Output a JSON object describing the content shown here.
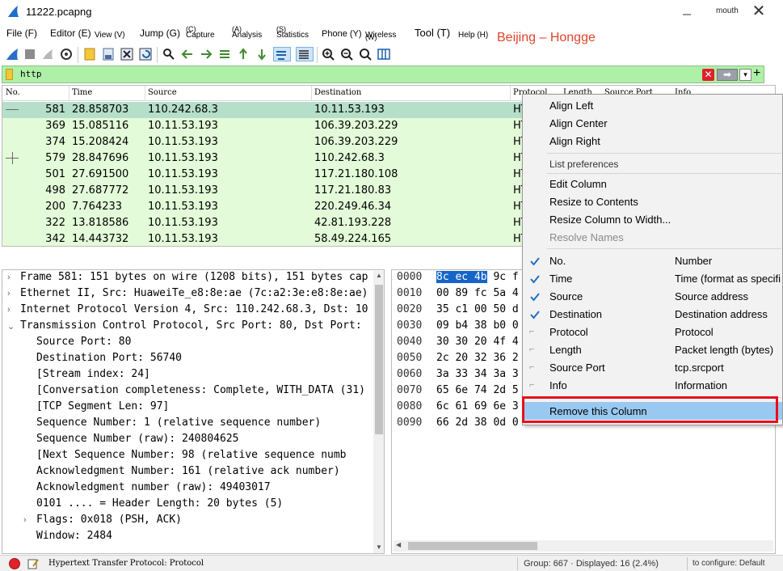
{
  "window": {
    "title": "11222.pcapng",
    "user_label": "mouth",
    "close_glyph": "✕",
    "min_glyph": "—"
  },
  "menubar": {
    "items": [
      {
        "label": "File (F)"
      },
      {
        "label": "Editor (E)"
      },
      {
        "label": "View (V)"
      },
      {
        "label": "Jump (G)"
      },
      {
        "label": "Capture",
        "key": "(C)"
      },
      {
        "label": "Analysis",
        "key": "(A)"
      },
      {
        "label": "Statistics",
        "key": "(S)"
      },
      {
        "label": "Phone (Y)"
      },
      {
        "label": "Wireless",
        "key": "(W)"
      },
      {
        "label": "Tool (T)"
      },
      {
        "label": "Help (H)"
      }
    ],
    "watermark": "Beijing – Hongge"
  },
  "filter": {
    "value": "http",
    "clear_glyph": "✕",
    "apply_glyph": "➡",
    "dropdown_glyph": "▾",
    "plus_glyph": "+"
  },
  "packet_list": {
    "columns": [
      "No.",
      "Time",
      "Source",
      "Destination",
      "Protocol",
      "Length",
      "Source Port",
      "Info"
    ],
    "rows": [
      {
        "no": "581",
        "time": "28.858703",
        "src": "110.242.68.3",
        "dst": "10.11.53.193",
        "proto": "HT"
      },
      {
        "no": "369",
        "time": "15.085116",
        "src": "10.11.53.193",
        "dst": "106.39.203.229",
        "proto": "HT"
      },
      {
        "no": "374",
        "time": "15.208424",
        "src": "10.11.53.193",
        "dst": "106.39.203.229",
        "proto": "HT"
      },
      {
        "no": "579",
        "time": "28.847696",
        "src": "10.11.53.193",
        "dst": "110.242.68.3",
        "proto": "HT"
      },
      {
        "no": "501",
        "time": "27.691500",
        "src": "10.11.53.193",
        "dst": "117.21.180.108",
        "proto": "HT"
      },
      {
        "no": "498",
        "time": "27.687772",
        "src": "10.11.53.193",
        "dst": "117.21.180.83",
        "proto": "HT"
      },
      {
        "no": "200",
        "time": "7.764233",
        "src": "10.11.53.193",
        "dst": "220.249.46.34",
        "proto": "HT"
      },
      {
        "no": "322",
        "time": "13.818586",
        "src": "10.11.53.193",
        "dst": "42.81.193.228",
        "proto": "HT"
      },
      {
        "no": "342",
        "time": "14.443732",
        "src": "10.11.53.193",
        "dst": "58.49.224.165",
        "proto": "HT"
      }
    ]
  },
  "details": {
    "lines": [
      {
        "text": "Frame 581: 151 bytes on wire (1208 bits), 151 bytes cap",
        "arrow": "›"
      },
      {
        "text": "Ethernet II, Src: HuaweiTe_e8:8e:ae (7c:a2:3e:e8:8e:ae)",
        "arrow": "›"
      },
      {
        "text": "Internet Protocol Version 4, Src: 110.242.68.3, Dst: 10",
        "arrow": "›"
      },
      {
        "text": "Transmission Control Protocol, Src Port: 80, Dst Port:",
        "arrow": "⌄"
      },
      {
        "text": "Source Port: 80"
      },
      {
        "text": "Destination Port: 56740"
      },
      {
        "text": "[Stream index: 24]"
      },
      {
        "text": "[Conversation completeness: Complete, WITH_DATA (31)"
      },
      {
        "text": "[TCP Segment Len: 97]"
      },
      {
        "text": "Sequence Number: 1    (relative sequence number)"
      },
      {
        "text": "Sequence Number (raw): 240804625"
      },
      {
        "text": "[Next Sequence Number: 98    (relative sequence numb"
      },
      {
        "text": "Acknowledgment Number: 161    (relative ack number)"
      },
      {
        "text": "Acknowledgment number (raw): 49403017"
      },
      {
        "text": "0101 .... = Header Length: 20 bytes (5)"
      },
      {
        "text": "Flags: 0x018 (PSH, ACK)",
        "arrow": "›"
      },
      {
        "text": "Window: 2484"
      }
    ]
  },
  "bytes": {
    "offsets": [
      "0000",
      "0010",
      "0020",
      "0030",
      "0040",
      "0050",
      "0060",
      "0070",
      "0080",
      "0090"
    ],
    "hex_selected": "8c ec 4b",
    "hex": [
      " 9c f",
      "00 89 fc 5a 4",
      "35 c1 00 50 d",
      "09 b4 38 b0 0",
      "30 30 20 4f 4",
      "2c 20 32 36 2",
      "3a 33 34 3a 3",
      "65 6e 74 2d 5",
      "6c 61 69 6e 3",
      "66 2d 38 0d 0"
    ]
  },
  "status": {
    "text": "Hypertext Transfer Protocol: Protocol",
    "packets": "Group: 667 · Displayed: 16 (2.4%)",
    "profile": "to configure: Default"
  },
  "context_menu": {
    "align_left": "Align Left",
    "align_center": "Align Center",
    "align_right": "Align Right",
    "list_prefs": "List preferences",
    "edit_column": "Edit Column",
    "resize_contents": "Resize to Contents",
    "resize_width": "Resize Column to Width...",
    "resolve_names": "Resolve Names",
    "columns": [
      {
        "name": "No.",
        "desc": "Number",
        "checked": true
      },
      {
        "name": "Time",
        "desc": "Time (format as specifi",
        "checked": true
      },
      {
        "name": "Source",
        "desc": "Source address",
        "checked": true
      },
      {
        "name": "Destination",
        "desc": "Destination address",
        "checked": true
      },
      {
        "name": "Protocol",
        "desc": "Protocol",
        "checked": false
      },
      {
        "name": "Length",
        "desc": "Packet length (bytes)",
        "checked": false
      },
      {
        "name": "Source Port",
        "desc": "tcp.srcport",
        "checked": false
      },
      {
        "name": "Info",
        "desc": "Information",
        "checked": false
      }
    ],
    "remove_column": "Remove this Column",
    "highlight_color": "#99c9f1",
    "annotation_color": "#e8101a"
  },
  "colors": {
    "filter_bg": "#aff0a8",
    "row_bg": "#e3fbd8",
    "row_selected_bg": "#b5dfc8",
    "hex_selected_bg": "#1565c8"
  }
}
